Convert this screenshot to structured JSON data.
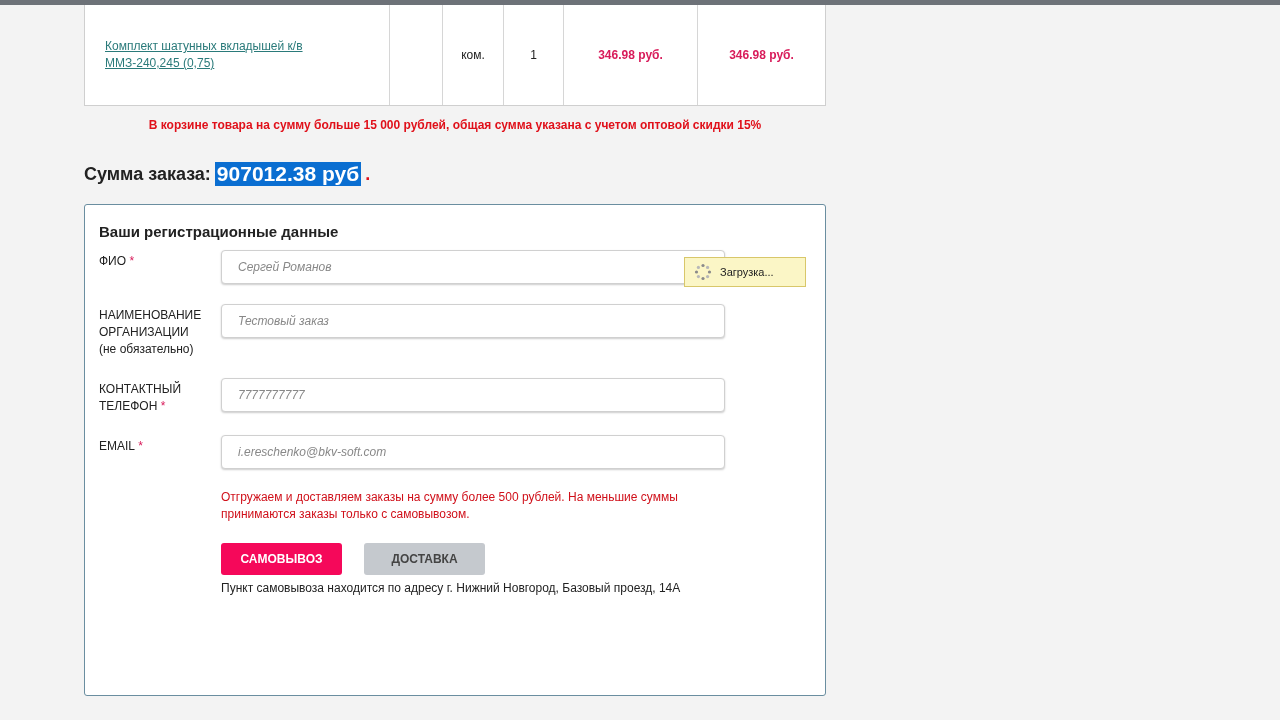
{
  "cart_table": {
    "rows": [
      {
        "product": "Комплект шатунных вкладышей к/в ММЗ-240,245 (0,75)",
        "unit": "ком.",
        "quantity": "1",
        "price": "346.98 руб.",
        "total": "346.98 руб."
      }
    ]
  },
  "discount_note": "В корзине товара на сумму больше 15 000 рублей, общая сумма указана с учетом оптовой скидки 15%",
  "order_total": {
    "label": "Сумма заказа:",
    "amount": "907012.38 руб",
    "end": "."
  },
  "registration": {
    "title": "Ваши регистрационные данные",
    "fields": [
      {
        "label": "ФИО",
        "required": true,
        "value": "Сергей Романов"
      },
      {
        "label": "НАИМЕНОВАНИЕ ОРГАНИЗАЦИИ",
        "hint": "(не обязательно)",
        "required": false,
        "value": "Тестовый заказ"
      },
      {
        "label": "КОНТАКТНЫЙ ТЕЛЕФОН",
        "required": true,
        "value": "7777777777"
      },
      {
        "label": "EMAIL",
        "required": true,
        "value": "i.ereschenko@bkv-soft.com"
      }
    ],
    "required_mark": "*",
    "shipping_note": "Отгружаем и доставляем заказы на сумму более 500 рублей. На меньшие суммы принимаются заказы только с самовывозом.",
    "delivery_options": [
      {
        "label": "САМОВЫВОЗ",
        "selected": true
      },
      {
        "label": "ДОСТАВКА",
        "selected": false
      }
    ],
    "pickup_address": "Пункт самовывоза находится по адресу г. Нижний Новгород, Базовый проезд, 14А"
  },
  "loading_popup": {
    "text": "Загрузка..."
  }
}
